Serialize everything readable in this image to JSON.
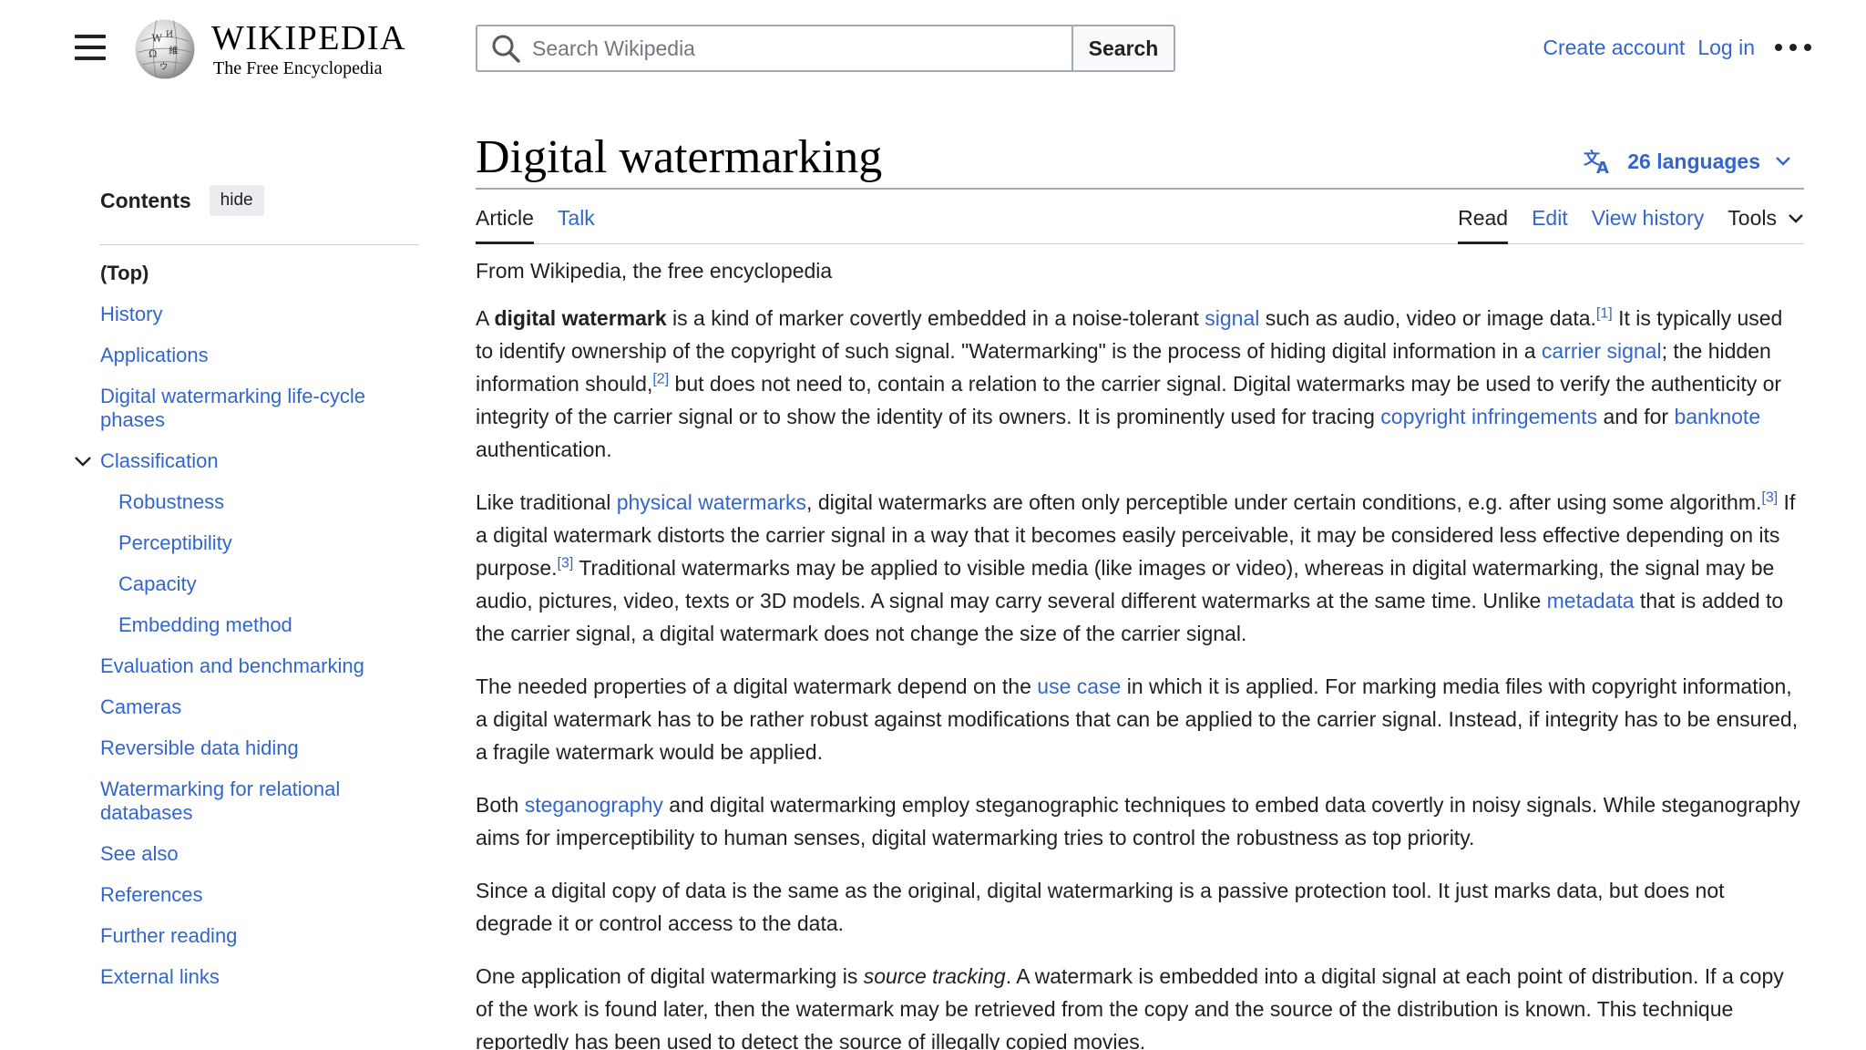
{
  "header": {
    "logo_title": "WIKIPEDIA",
    "logo_tagline": "The Free Encyclopedia",
    "search_placeholder": "Search Wikipedia",
    "search_button": "Search",
    "create_account": "Create account",
    "log_in": "Log in"
  },
  "toc": {
    "title": "Contents",
    "hide": "hide",
    "items": [
      {
        "label": "(Top)"
      },
      {
        "label": "History"
      },
      {
        "label": "Applications"
      },
      {
        "label": "Digital watermarking life-cycle phases"
      },
      {
        "label": "Classification"
      },
      {
        "label": "Robustness"
      },
      {
        "label": "Perceptibility"
      },
      {
        "label": "Capacity"
      },
      {
        "label": "Embedding method"
      },
      {
        "label": "Evaluation and benchmarking"
      },
      {
        "label": "Cameras"
      },
      {
        "label": "Reversible data hiding"
      },
      {
        "label": "Watermarking for relational databases"
      },
      {
        "label": "See also"
      },
      {
        "label": "References"
      },
      {
        "label": "Further reading"
      },
      {
        "label": "External links"
      }
    ]
  },
  "article": {
    "title": "Digital watermarking",
    "languages": "26 languages",
    "tabs": {
      "article": "Article",
      "talk": "Talk",
      "read": "Read",
      "edit": "Edit",
      "history": "View history",
      "tools": "Tools"
    },
    "site_tagline": "From Wikipedia, the free encyclopedia",
    "p1": {
      "a": "A ",
      "b": "digital watermark",
      "c": " is a kind of marker covertly embedded in a noise-tolerant ",
      "link1": "signal",
      "d": " such as audio, video or image data.",
      "ref1": "[1]",
      "e": " It is typically used to identify ownership of the copyright of such signal. \"Watermarking\" is the process of hiding digital information in a ",
      "link2": "carrier signal",
      "f": "; the hidden information should,",
      "ref2": "[2]",
      "g": " but does not need to, contain a relation to the carrier signal. Digital watermarks may be used to verify the authenticity or integrity of the carrier signal or to show the identity of its owners. It is prominently used for tracing ",
      "link3": "copyright infringements",
      "h": " and for ",
      "link4": "banknote",
      "i": " authentication."
    },
    "p2": {
      "a": "Like traditional ",
      "link1": "physical watermarks",
      "b": ", digital watermarks are often only perceptible under certain conditions, e.g. after using some algorithm.",
      "ref1": "[3]",
      "c": " If a digital watermark distorts the carrier signal in a way that it becomes easily perceivable, it may be considered less effective depending on its purpose.",
      "ref2": "[3]",
      "d": " Traditional watermarks may be applied to visible media (like images or video), whereas in digital watermarking, the signal may be audio, pictures, video, texts or 3D models. A signal may carry several different watermarks at the same time. Unlike ",
      "link2": "metadata",
      "e": " that is added to the carrier signal, a digital watermark does not change the size of the carrier signal."
    },
    "p3": {
      "a": "The needed properties of a digital watermark depend on the ",
      "link1": "use case",
      "b": " in which it is applied. For marking media files with copyright information, a digital watermark has to be rather robust against modifications that can be applied to the carrier signal. Instead, if integrity has to be ensured, a fragile watermark would be applied."
    },
    "p4": {
      "a": "Both ",
      "link1": "steganography",
      "b": " and digital watermarking employ steganographic techniques to embed data covertly in noisy signals. While steganography aims for imperceptibility to human senses, digital watermarking tries to control the robustness as top priority."
    },
    "p5": {
      "a": "Since a digital copy of data is the same as the original, digital watermarking is a passive protection tool. It just marks data, but does not degrade it or control access to the data."
    },
    "p6": {
      "a": "One application of digital watermarking is ",
      "em": "source tracking",
      "b": ". A watermark is embedded into a digital signal at each point of distribution. If a copy of the work is found later, then the watermark may be retrieved from the copy and the source of the distribution is known. This technique reportedly has been used to detect the source of illegally copied movies."
    }
  }
}
